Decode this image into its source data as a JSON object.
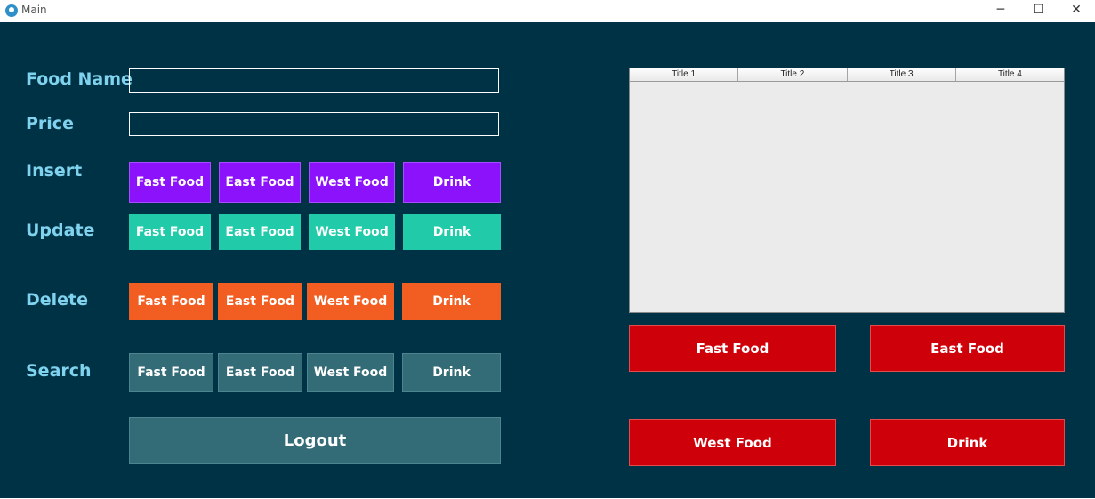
{
  "window": {
    "title": "Main",
    "minimize_glyph": "─",
    "maximize_glyph": "☐",
    "close_glyph": "✕"
  },
  "form": {
    "food_name_label": "Food Name",
    "price_label": "Price",
    "food_name_value": "",
    "price_value": ""
  },
  "actions": {
    "insert": {
      "label": "Insert",
      "buttons": [
        "Fast Food",
        "East Food",
        "West Food",
        "Drink"
      ],
      "color": "#8b12fb"
    },
    "update": {
      "label": "Update",
      "buttons": [
        "Fast Food",
        "East Food",
        "West Food",
        "Drink"
      ],
      "color": "#21cbaa"
    },
    "delete": {
      "label": "Delete",
      "buttons": [
        "Fast Food",
        "East Food",
        "West Food",
        "Drink"
      ],
      "color": "#f25e21"
    },
    "search": {
      "label": "Search",
      "buttons": [
        "Fast Food",
        "East Food",
        "West Food",
        "Drink"
      ],
      "color": "#336b77"
    }
  },
  "logout_label": "Logout",
  "table": {
    "columns": [
      "Title 1",
      "Title 2",
      "Title 3",
      "Title 4"
    ],
    "rows": []
  },
  "category_buttons": [
    "Fast Food",
    "East Food",
    "West Food",
    "Drink"
  ],
  "colors": {
    "background": "#003246",
    "label": "#7fd3ee",
    "category": "#ce0009"
  }
}
